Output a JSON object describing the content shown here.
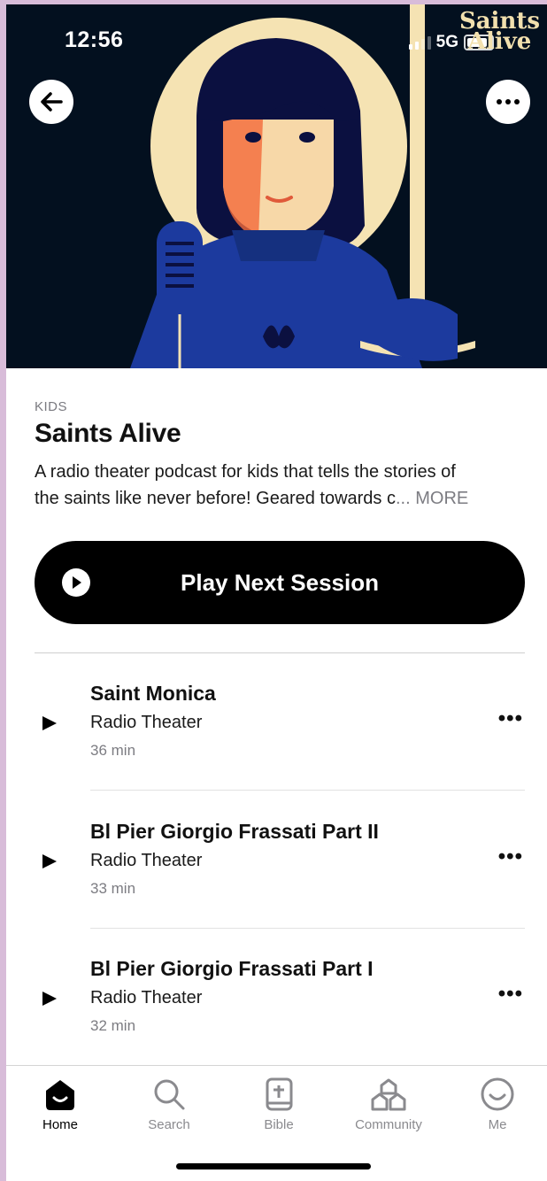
{
  "status_bar": {
    "time": "12:56",
    "network": "5G"
  },
  "hero": {
    "logo_line1": "Saints",
    "logo_line2": "Alive"
  },
  "show": {
    "category": "KIDS",
    "title": "Saints Alive",
    "description_line1": "A radio theater podcast for kids that tells the stories of",
    "description_line2": "the saints like never before! Geared towards c",
    "description_more": "... MORE"
  },
  "play_next_label": "Play Next Session",
  "episodes": [
    {
      "title": "Saint Monica",
      "subtitle": "Radio Theater",
      "duration": "36 min"
    },
    {
      "title": "Bl Pier Giorgio Frassati Part II",
      "subtitle": "Radio Theater",
      "duration": "33 min"
    },
    {
      "title": "Bl Pier Giorgio Frassati Part I",
      "subtitle": "Radio Theater",
      "duration": "32 min"
    }
  ],
  "tabs": [
    {
      "label": "Home",
      "icon": "home-icon",
      "active": true
    },
    {
      "label": "Search",
      "icon": "search-icon",
      "active": false
    },
    {
      "label": "Bible",
      "icon": "bible-icon",
      "active": false
    },
    {
      "label": "Community",
      "icon": "community-icon",
      "active": false
    },
    {
      "label": "Me",
      "icon": "smile-icon",
      "active": false
    }
  ],
  "colors": {
    "hero_bg": "#03101f",
    "halo": "#f5e3b3",
    "armor_blue": "#1c3a9e",
    "accent": "#000000"
  }
}
